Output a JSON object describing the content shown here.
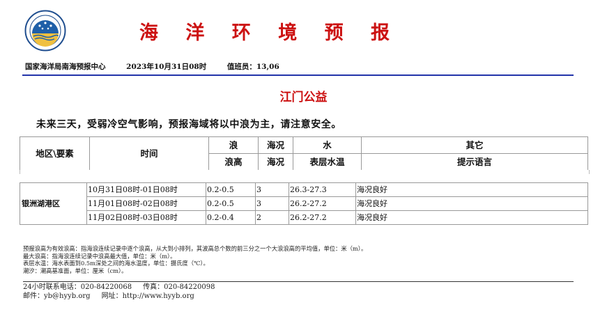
{
  "header": {
    "title": "海 洋 环 境 预 报",
    "issuer": "国家海洋局南海预报中心",
    "issue_time": "2023年10月31日08时",
    "duty": "值班员：13,06"
  },
  "site": {
    "name": "江门公益"
  },
  "summary": "未来三天，受弱冷空气影响，预报海域将以中浪为主，请注意安全。",
  "table": {
    "head": {
      "region": "地区\\要素",
      "time": "时间",
      "wave": "浪",
      "sea": "海况",
      "water": "水",
      "other": "其它",
      "wave_height": "浪高",
      "sea_state": "海况",
      "sst": "表层水温",
      "hint": "提示语言"
    },
    "region": "银洲湖港区",
    "rows": [
      {
        "time": "10月31日08时-01日08时",
        "wave": "0.2-0.5",
        "sea": "3",
        "temp": "26.3-27.3",
        "hint": "海况良好"
      },
      {
        "time": "11月01日08时-02日08时",
        "wave": "0.2-0.5",
        "sea": "3",
        "temp": "26.2-27.2",
        "hint": "海况良好"
      },
      {
        "time": "11月02日08时-03日08时",
        "wave": "0.2-0.4",
        "sea": "2",
        "temp": "26.2-27.2",
        "hint": "海况良好"
      }
    ]
  },
  "notes": [
    "预报浪高为有效浪高：指海浪连续记录中逐个浪高，从大到小排列，其波高总个数的前三分之一个大浪浪高的平均值，单位：米（m）。",
    "最大浪高：指海浪连续记录中浪高最大值，单位：米（m）。",
    "表层水温：海水表面到0.5m深处之间的海水温度，单位：摄氏度（℃）。",
    "潮汐：潮高基准面，单位：厘米（cm）。"
  ],
  "contact": {
    "phone": "24小时联系电话：020-84220068",
    "fax": "传真：020-84220098",
    "email": "邮件：yb@hyyb.org",
    "site": "网址：http://www.hyyb.org"
  },
  "colors": {
    "logo_ring": "#1f4e8f",
    "rule": "#2233aa",
    "title": "#cc1111",
    "subtitle": "#cc1111"
  }
}
